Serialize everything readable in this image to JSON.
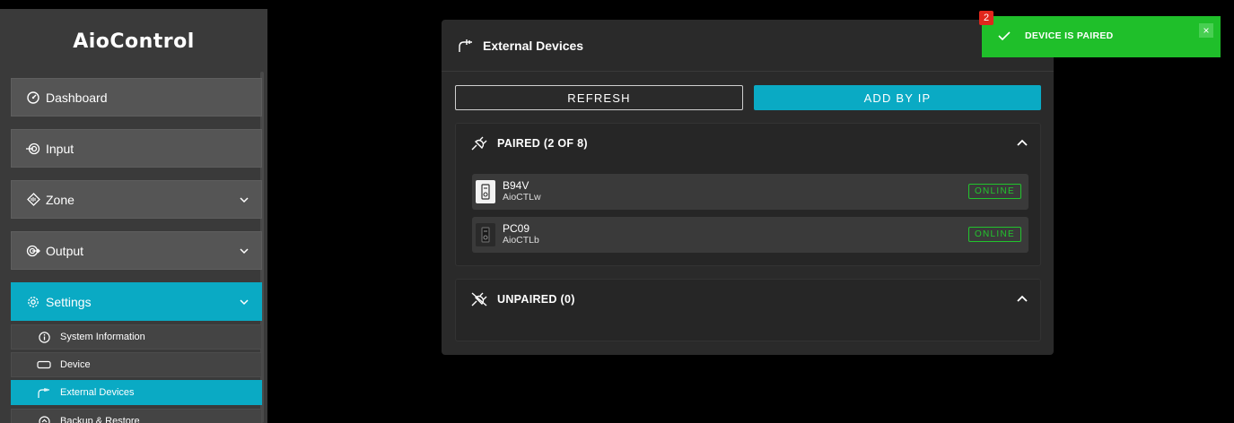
{
  "app": {
    "title": "AioControl"
  },
  "sidebar": {
    "items": [
      {
        "label": "Dashboard",
        "icon": "dashboard-icon"
      },
      {
        "label": "Input",
        "icon": "input-icon"
      },
      {
        "label": "Zone",
        "icon": "zone-icon",
        "expandable": true
      },
      {
        "label": "Output",
        "icon": "output-icon",
        "expandable": true
      },
      {
        "label": "Settings",
        "icon": "settings-icon",
        "expandable": true,
        "active": true
      }
    ],
    "sub_items": [
      {
        "label": "System Information",
        "icon": "info-icon"
      },
      {
        "label": "Device",
        "icon": "device-icon"
      },
      {
        "label": "External Devices",
        "icon": "external-devices-icon",
        "active": true
      },
      {
        "label": "Backup & Restore",
        "icon": "backup-icon"
      }
    ]
  },
  "panel": {
    "title": "External Devices",
    "refresh_label": "REFRESH",
    "add_label": "ADD BY IP",
    "paired": {
      "title": "PAIRED (2 OF 8)",
      "devices": [
        {
          "name": "B94V",
          "model": "AioCTLw",
          "status": "ONLINE",
          "icon_style": "light"
        },
        {
          "name": "PC09",
          "model": "AioCTLb",
          "status": "ONLINE",
          "icon_style": "dark"
        }
      ]
    },
    "unpaired": {
      "title": "UNPAIRED (0)"
    }
  },
  "toast": {
    "message": "DEVICE IS PAIRED",
    "count": "2",
    "close": "×"
  },
  "colors": {
    "accent": "#0aaac4",
    "success": "#1fbf2a",
    "online": "#22c42d",
    "badge": "#e0271c"
  }
}
